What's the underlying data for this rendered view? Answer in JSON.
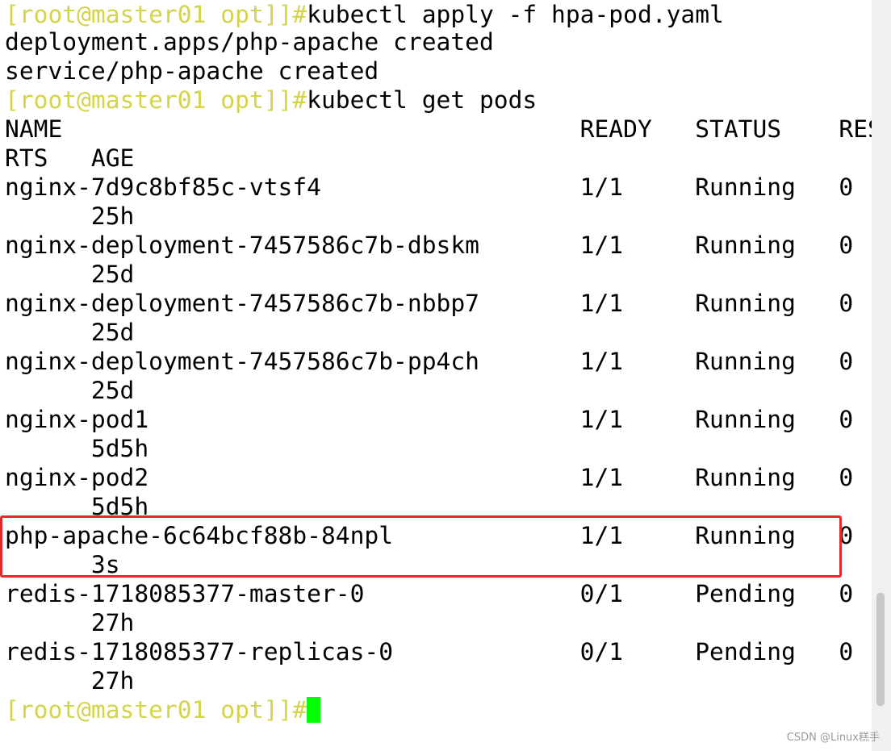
{
  "terminal": {
    "prompt": "[root@master01 opt]]#",
    "commands": [
      "kubectl apply -f hpa-pod.yaml",
      "kubectl get pods"
    ],
    "apply_output": [
      "deployment.apps/php-apache created",
      "service/php-apache created"
    ],
    "table": {
      "header": "NAME                                    READY   STATUS    RESTA",
      "header_wrap": "RTS   AGE",
      "rows": [
        {
          "main": "nginx-7d9c8bf85c-vtsf4                  1/1     Running   0",
          "wrap": "      25h"
        },
        {
          "main": "nginx-deployment-7457586c7b-dbskm       1/1     Running   0",
          "wrap": "      25d"
        },
        {
          "main": "nginx-deployment-7457586c7b-nbbp7       1/1     Running   0",
          "wrap": "      25d"
        },
        {
          "main": "nginx-deployment-7457586c7b-pp4ch       1/1     Running   0",
          "wrap": "      25d"
        },
        {
          "main": "nginx-pod1                              1/1     Running   0",
          "wrap": "      5d5h"
        },
        {
          "main": "nginx-pod2                              1/1     Running   0",
          "wrap": "      5d5h"
        },
        {
          "main": "php-apache-6c64bcf88b-84npl             1/1     Running   0",
          "wrap": "      3s"
        },
        {
          "main": "redis-1718085377-master-0               0/1     Pending   0",
          "wrap": "      27h"
        },
        {
          "main": "redis-1718085377-replicas-0             0/1     Pending   0",
          "wrap": "      27h"
        }
      ]
    }
  },
  "watermark": "CSDN @Linux糕手",
  "colors": {
    "prompt": "#d4d44a",
    "text": "#000000",
    "cursor": "#00ff00",
    "highlight": "#e8272e",
    "background": "#ffffff"
  }
}
